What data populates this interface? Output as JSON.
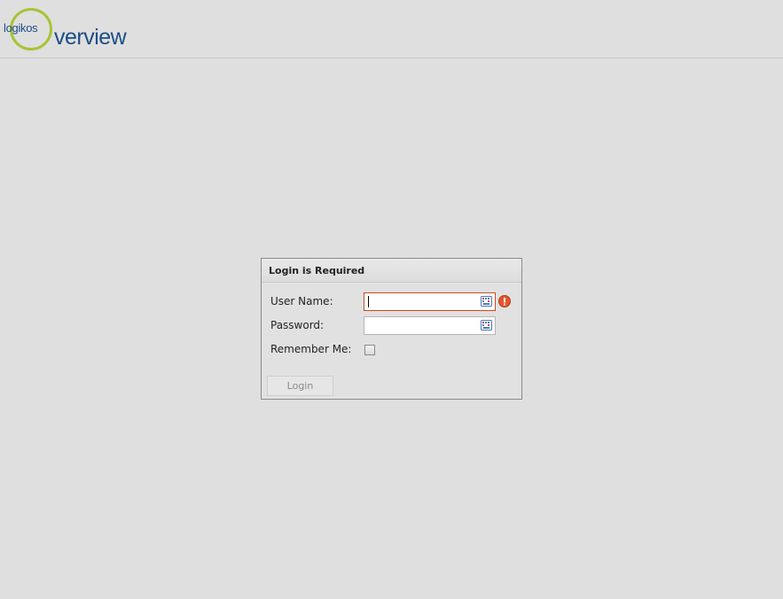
{
  "header": {
    "logo_small": "logikos",
    "logo_big": "verview"
  },
  "dialog": {
    "title": "Login is Required",
    "username_label": "User Name:",
    "username_value": "",
    "password_label": "Password:",
    "password_value": "",
    "remember_label": "Remember Me:",
    "remember_checked": false,
    "login_label": "Login"
  },
  "colors": {
    "logo_ring": "#a6c436",
    "logo_text": "#1b4d87",
    "invalid_border": "#c94b1c",
    "error_icon": "#e2572b"
  },
  "icons": {
    "keyboard": "virtual-keyboard-icon",
    "error": "exclamation-icon"
  }
}
